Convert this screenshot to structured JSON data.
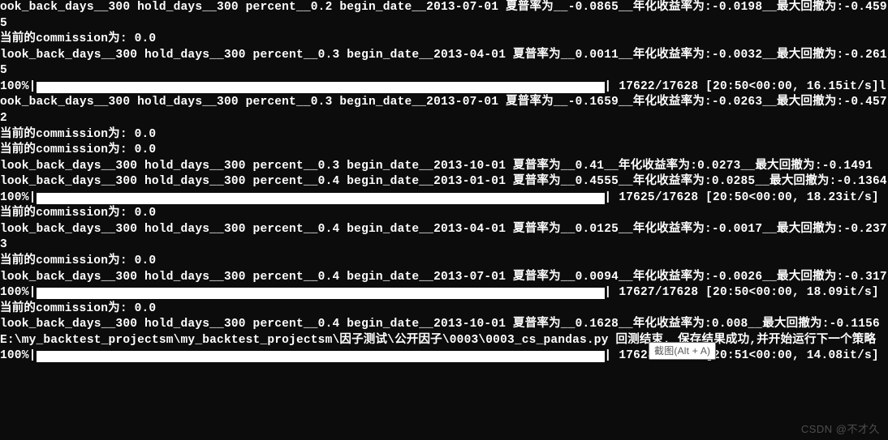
{
  "lines": {
    "l0": "ook_back_days__300 hold_days__300 percent__0.2 begin_date__2013-07-01 夏普率为__-0.0865__年化收益率为:-0.0198__最大回撤为:-0.4595",
    "l1": "当前的commission为: 0.0",
    "l2": "look_back_days__300 hold_days__300 percent__0.3 begin_date__2013-04-01 夏普率为__0.0011__年化收益率为:-0.0032__最大回撤为:-0.2615",
    "p1_label": "100%|",
    "p1_stats": "| 17622/17628 [20:50<00:00, 16.15it/s]l",
    "l3": "ook_back_days__300 hold_days__300 percent__0.3 begin_date__2013-07-01 夏普率为__-0.1659__年化收益率为:-0.0263__最大回撤为:-0.4572",
    "l4": "当前的commission为: 0.0",
    "l5": "当前的commission为: 0.0",
    "l6": "look_back_days__300 hold_days__300 percent__0.3 begin_date__2013-10-01 夏普率为__0.41__年化收益率为:0.0273__最大回撤为:-0.1491",
    "l7": "look_back_days__300 hold_days__300 percent__0.4 begin_date__2013-01-01 夏普率为__0.4555__年化收益率为:0.0285__最大回撤为:-0.1364",
    "p2_label": "100%|",
    "p2_stats": "| 17625/17628 [20:50<00:00, 18.23it/s]",
    "l8": "当前的commission为: 0.0",
    "l9": "look_back_days__300 hold_days__300 percent__0.4 begin_date__2013-04-01 夏普率为__0.0125__年化收益率为:-0.0017__最大回撤为:-0.2373",
    "l10": "当前的commission为: 0.0",
    "l11": "look_back_days__300 hold_days__300 percent__0.4 begin_date__2013-07-01 夏普率为__0.0094__年化收益率为:-0.0026__最大回撤为:-0.317",
    "p3_label": "100%|",
    "p3_stats": "| 17627/17628 [20:50<00:00, 18.09it/s]",
    "l12": "当前的commission为: 0.0",
    "l13": "look_back_days__300 hold_days__300 percent__0.4 begin_date__2013-10-01 夏普率为__0.1628__年化收益率为:0.008__最大回撤为:-0.1156",
    "l14": "E:\\my_backtest_projectsm\\my_backtest_projectsm\\因子测试\\公开因子\\0003\\0003_cs_pandas.py 回测结束, 保存结果成功,并开始运行下一个策略",
    "p4_label": "100%|",
    "p4_stats": "| 17628/17628 [20:51<00:00, 14.08it/s]"
  },
  "tooltip": "截图(Alt + A)",
  "watermark": "CSDN @不才久"
}
